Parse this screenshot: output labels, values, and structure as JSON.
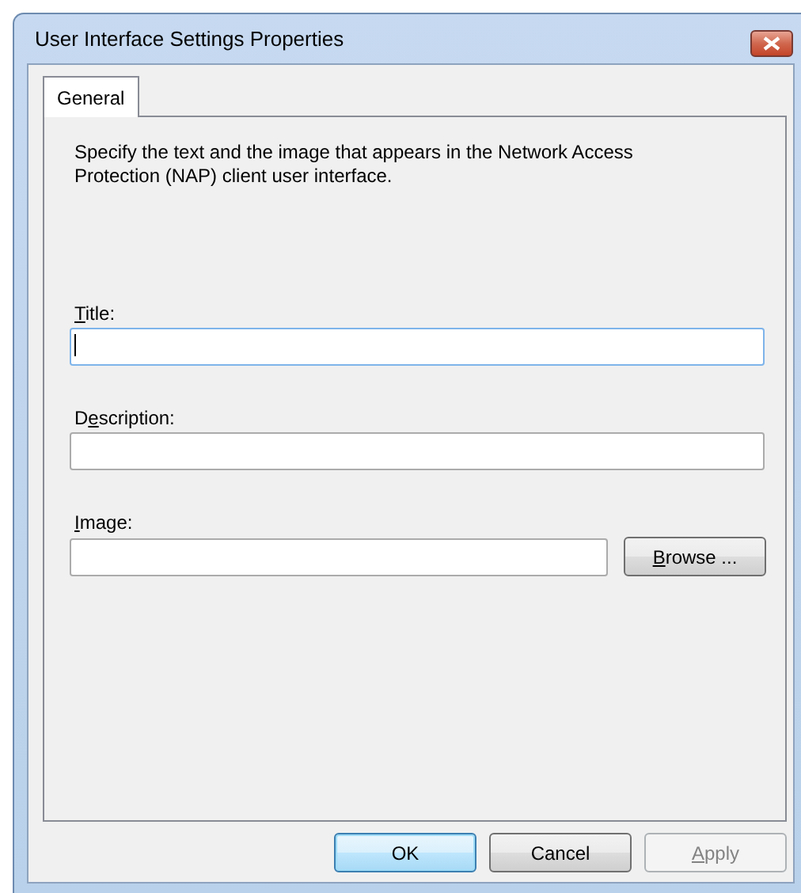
{
  "window": {
    "title": "User Interface Settings Properties"
  },
  "tabs": [
    {
      "label": "General",
      "selected": true
    }
  ],
  "intro": "Specify the text and the image that appears in the Network Access Protection (NAP) client user interface.",
  "fields": [
    {
      "kind": "text",
      "label": {
        "key": "T",
        "after": "itle:"
      },
      "focused": true
    },
    {
      "kind": "text",
      "label": {
        "before": "D",
        "key": "e",
        "after": "scription:"
      },
      "focused": false
    },
    {
      "kind": "browse",
      "label": {
        "key": "I",
        "after": "mage:"
      },
      "focused": false,
      "button": {
        "key": "B",
        "after": "rowse ..."
      }
    }
  ],
  "buttons": [
    {
      "label": {
        "after": "OK"
      },
      "default": true,
      "disabled": false
    },
    {
      "label": {
        "after": "Cancel"
      },
      "default": false,
      "disabled": false
    },
    {
      "label": {
        "key": "A",
        "after": "pply"
      },
      "default": false,
      "disabled": true
    }
  ]
}
